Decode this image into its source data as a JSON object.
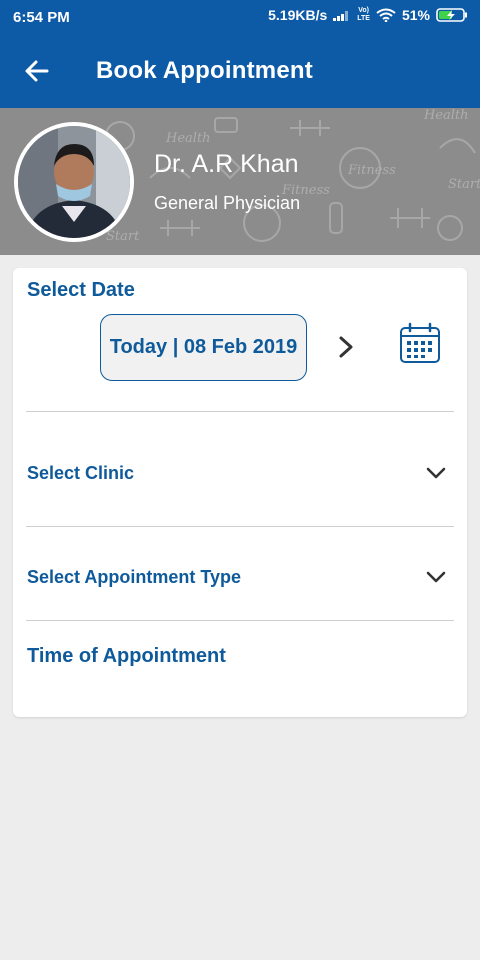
{
  "status_bar": {
    "time": "6:54 PM",
    "network_speed": "5.19KB/s",
    "volte_top": "Vo)",
    "volte_bottom": "LTE",
    "battery": "51%"
  },
  "app_bar": {
    "title": "Book Appointment",
    "back_icon": "arrow-left-icon"
  },
  "doctor": {
    "name": "Dr. A.R Khan",
    "specialty": "General Physician",
    "banner_words": [
      "Health",
      "Fitness",
      "Start",
      "Fitness",
      "Health",
      "Start"
    ]
  },
  "form": {
    "select_date_label": "Select Date",
    "date_value": "Today | 08 Feb 2019",
    "next_icon": "chevron-right-icon",
    "calendar_icon": "calendar-icon",
    "select_clinic_label": "Select Clinic",
    "select_type_label": "Select Appointment Type",
    "time_label": "Time of Appointment"
  },
  "colors": {
    "primary": "#0d5aa7",
    "label": "#0f5a9a",
    "background": "#ededed"
  }
}
